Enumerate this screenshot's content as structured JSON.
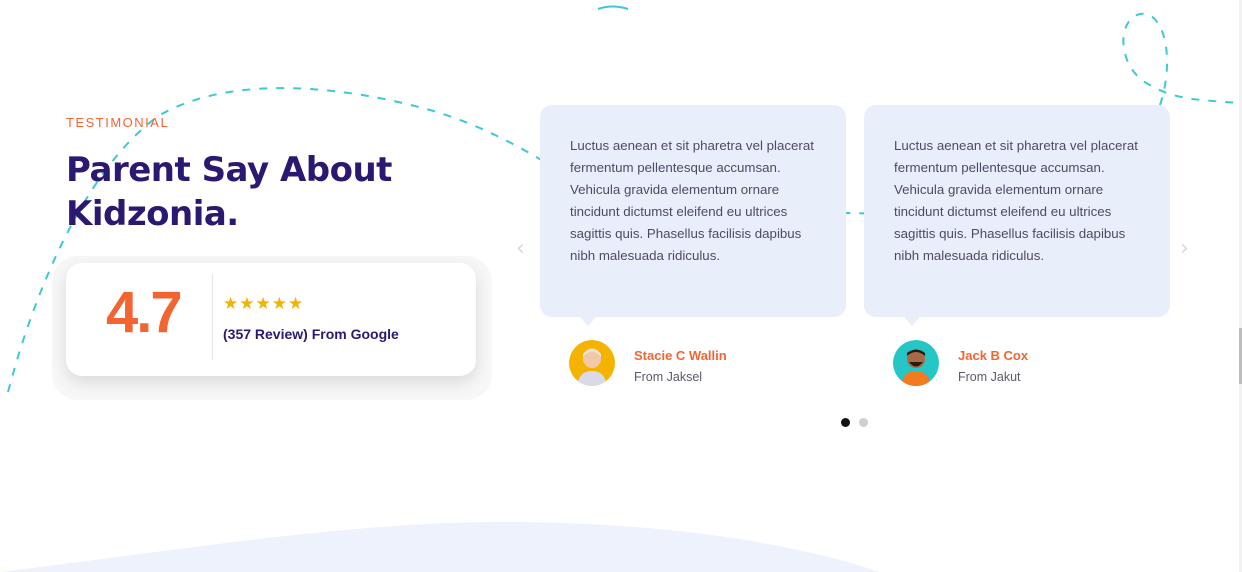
{
  "section": {
    "eyebrow": "TESTIMONIAL",
    "title_line1": "Parent Say About",
    "title_line2": "Kidzonia."
  },
  "rating": {
    "score": "4.7",
    "stars": "★★★★★",
    "review_text": "(357 Review) From Google",
    "star_count": 5
  },
  "testimonials": [
    {
      "quote": "Luctus aenean et sit pharetra vel placerat fermentum pellentesque accumsan. Vehicula gravida elementum ornare tincidunt dictumst eleifend eu ultrices sagittis quis. Phasellus facilisis dapibus nibh malesuada ridiculus.",
      "name": "Stacie C Wallin",
      "location": "From Jaksel",
      "avatar_bg": "#f5b301"
    },
    {
      "quote": "Luctus aenean et sit pharetra vel placerat fermentum pellentesque accumsan. Vehicula gravida elementum ornare tincidunt dictumst eleifend eu ultrices sagittis quis. Phasellus facilisis dapibus nibh malesuada ridiculus.",
      "name": "Jack B Cox",
      "location": "From Jakut",
      "avatar_bg": "#26c6c6"
    }
  ],
  "carousel": {
    "prev_icon": "chevron-left-icon",
    "next_icon": "chevron-right-icon",
    "page_count": 2,
    "active_page": 1
  },
  "colors": {
    "accent": "#f26532",
    "heading": "#2b1870",
    "bubble": "#e9eefb",
    "dash_line": "#3cc9cf",
    "star": "#f5b301"
  }
}
